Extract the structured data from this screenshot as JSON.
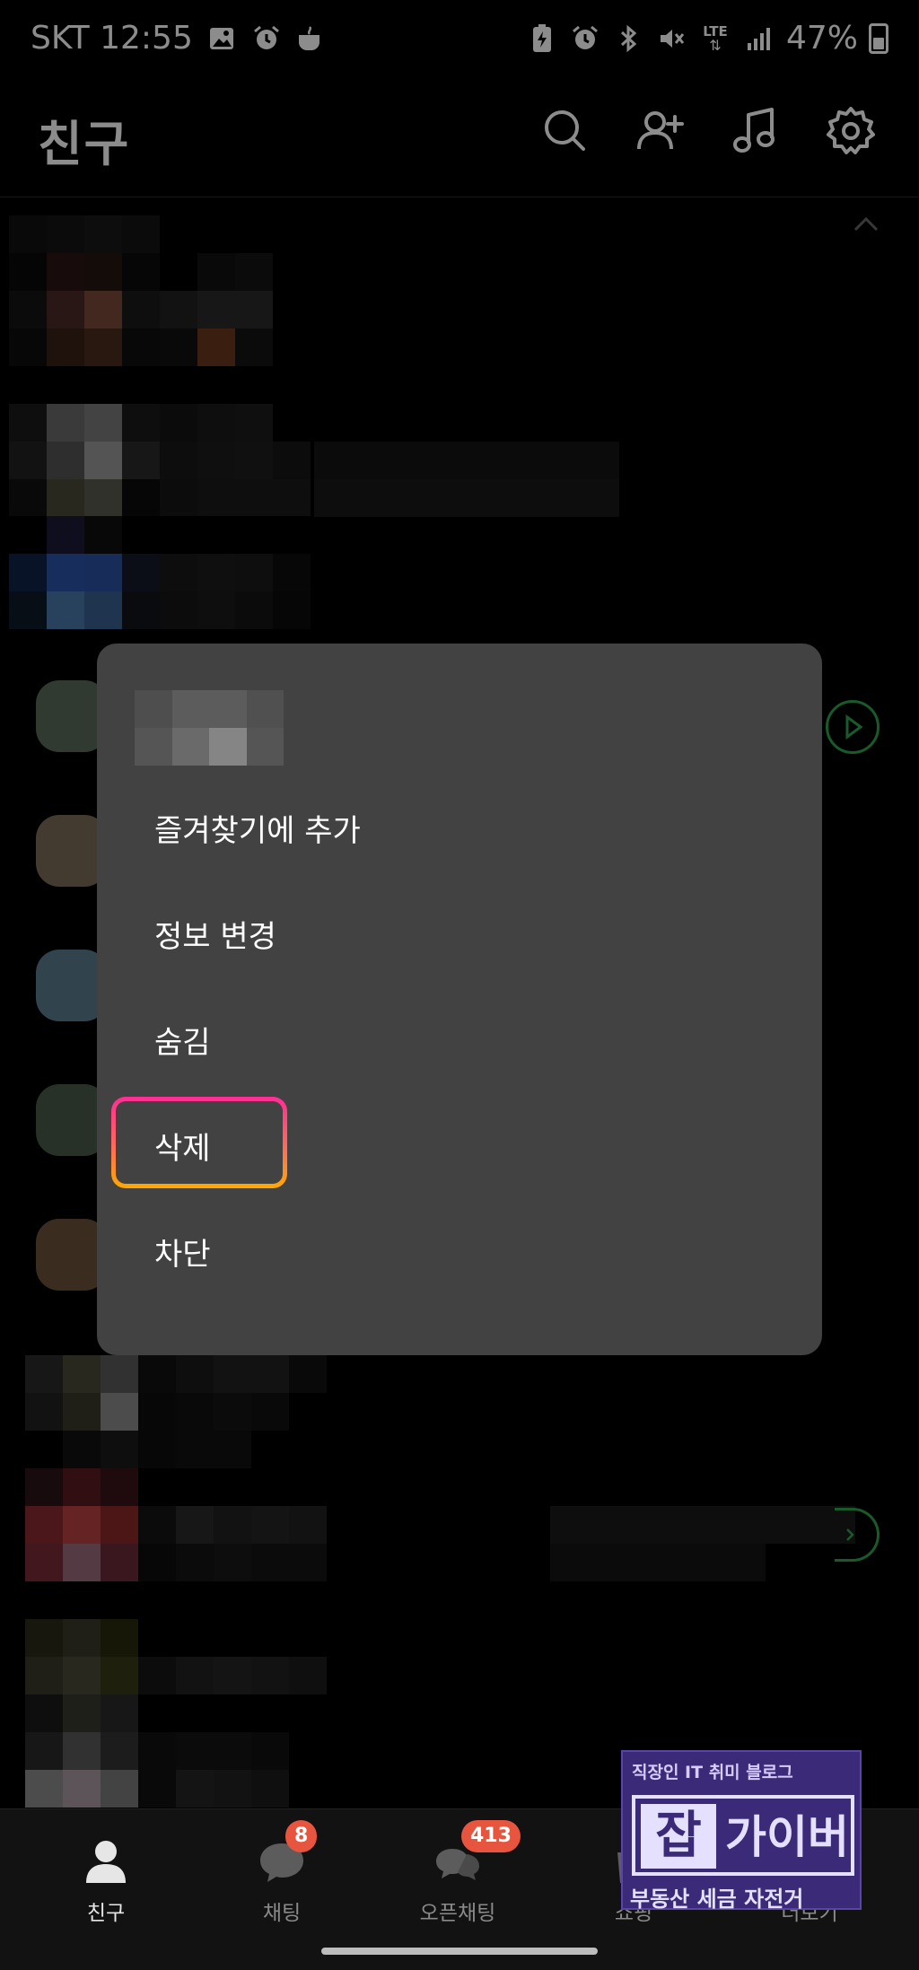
{
  "status_bar": {
    "carrier_time": "SKT 12:55",
    "battery": "47%",
    "network": "LTE",
    "left_icons": [
      "gallery-icon",
      "alarm-icon",
      "cup-icon"
    ],
    "right_icons": [
      "battery-saver-icon",
      "alarm-icon",
      "bluetooth-icon",
      "mute-icon",
      "lte-icon",
      "signal-icon",
      "battery-icon"
    ]
  },
  "header": {
    "title": "친구",
    "icons": [
      "search-icon",
      "add-friend-icon",
      "music-icon",
      "settings-icon"
    ]
  },
  "context_menu": {
    "items": [
      {
        "label": "즐겨찾기에 추가"
      },
      {
        "label": "정보 변경"
      },
      {
        "label": "숨김"
      },
      {
        "label": "삭제",
        "highlighted": true
      },
      {
        "label": "차단"
      }
    ],
    "highlight_colors": [
      "#ff2d95",
      "#ffa800"
    ]
  },
  "bottom_nav": {
    "items": [
      {
        "label": "친구",
        "icon": "person-icon",
        "active": true
      },
      {
        "label": "채팅",
        "icon": "chat-icon",
        "badge": "8"
      },
      {
        "label": "오픈채팅",
        "icon": "open-chat-icon",
        "badge": "413"
      },
      {
        "label": "쇼핑",
        "icon": "shopping-icon"
      },
      {
        "label": "더보기",
        "icon": "more-icon"
      }
    ]
  },
  "watermark": {
    "tagline": "직장인 IT 취미 블로그",
    "logo_char": "잡",
    "name": "가이버",
    "subtitle": "부동산 세금 자전거"
  },
  "colors": {
    "background": "#000000",
    "menu_bg": "#424242",
    "accent_green": "#2ea44f",
    "badge_red": "#e8553e"
  }
}
